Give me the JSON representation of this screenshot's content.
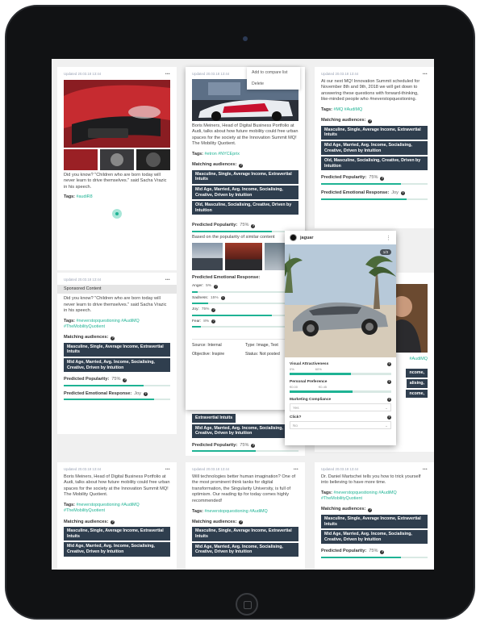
{
  "cards": {
    "c1": {
      "updated": "Updated 20.03.18 13:44",
      "more": "•••",
      "text": "Did you know? \"Children who are born today will never learn to drive themselves.\" said Sacha Vrazic in his speech.",
      "tags_label": "Tags:",
      "tags": "#audiR8"
    },
    "c2": {
      "updated": "Updated 20.03.18 13:44",
      "menu_add": "Add to compare list",
      "menu_delete": "Delete",
      "text": "Boris Meiners, Head of Digital Business Portfolio at Audi, talks about how future mobility could free urban spaces for the society at the Innovation Summit MQ! The Mobility Quotient.",
      "tags_label": "Tags:",
      "tags": "#etron #NYCEprix",
      "matching": "Matching audiences:",
      "aud1": "Masculine, Single, Average Income, Extravertial Intuits",
      "aud2": "Mid Age, Married, Avg. Income, Socialising, Creative, Driven by Intuition",
      "aud3": "Old, Masculine, Socialising, Creative, Driven by Intuition",
      "pop_label": "Predicted Popularity:",
      "pop_val": "75%",
      "similar": "Based on the popularity of similar content",
      "emo_label": "Predicted Emotional Response:",
      "anger_label": "Anger:",
      "anger_val": "5%",
      "sadness_label": "Sadness:",
      "sadness_val": "15%",
      "joy_label": "Joy:",
      "joy_val": "75%",
      "fear_label": "Fear:",
      "fear_val": "8%",
      "source_k": "Source:",
      "source_v": "Internal",
      "type_k": "Type:",
      "type_v": "Image, Text",
      "objective_k": "Objective:",
      "objective_v": "Inspire",
      "status_k": "Status:",
      "status_v": "Not posted"
    },
    "c3": {
      "updated": "Updated 20.03.18 13:44",
      "more": "•••",
      "text": "At our next MQ! Innovation Summit scheduled for November 8th and 9th, 2018 we will get down to answering these questions with forward-thinking, like-minded people who #neverstopquestioning.",
      "tags_label": "Tags:",
      "tags": "#MQ #AudiMQ",
      "matching": "Matching audiences:",
      "aud1": "Masculine, Single, Average Income, Extravertial Intuits",
      "aud2": "Mid Age, Married, Avg. Income, Socialising, Creative, Driven by Intuition",
      "aud3": "Old, Masculine, Socialising, Creative, Driven by Intuition",
      "pop_label": "Predicted Popularity:",
      "pop_val": "75%",
      "emo_label": "Predicted Emotional Response:",
      "emo_val": "Joy"
    },
    "c4": {
      "updated": "Updated 20.03.18 13:44",
      "more": "•••",
      "sponsored": "Sponsored Content",
      "text": "Did you know? \"Children who are born today will never learn to drive themselves.\" said Sacha Vrazic in his speech.",
      "tags_label": "Tags:",
      "tags": "#neverstopquestioning #AudiMQ #TheMobilityQuotient",
      "matching": "Matching audiences:",
      "aud1": "Masculine, Single, Average Income, Extravertial Intuits",
      "aud2": "Mid Age, Married, Avg. Income, Socialising, Creative, Driven by Intuition",
      "pop_label": "Predicted Popularity:",
      "pop_val": "75%",
      "emo_label": "Predicted Emotional Response:",
      "emo_val": "Joy"
    },
    "c5": {
      "aud1": "Extravertial Intuits",
      "aud2": "Mid Age, Married, Avg. Income, Socialising, Creative, Driven by Intuition",
      "pop_label": "Predicted Popularity:",
      "pop_val": "75%"
    },
    "c6": {
      "tags": "#AudiMQ",
      "aud_frag1": "ncome,",
      "aud_frag2": "alising,",
      "aud_frag3": "ncome,"
    },
    "c7": {
      "updated": "Updated 20.03.18 13:44",
      "more": "•••",
      "text": "Boris Meiners, Head of Digital Business Portfolio at Audi, talks about how future mobility could free urban spaces for the society at the Innovation Summit MQ! The Mobility Quotient.",
      "tags_label": "Tags:",
      "tags": "#neverstopquestioning #AudiMQ #TheMobilityQuotient",
      "matching": "Matching audiences:",
      "aud1": "Masculine, Single, Average Income, Extravertial Intuits",
      "aud2": "Mid Age, Married, Avg. Income, Socialising, Creative, Driven by Intuition"
    },
    "c8": {
      "updated": "Updated 20.03.18 13:44",
      "more": "•••",
      "text": "Will technologies better human imagination? One of the most prominent think tanks for digital transformation, the Singularity University, is full of optimism. Our reading tip for today comes highly recommended!",
      "tags_label": "Tags:",
      "tags": "#neverstopquestioning #AudiMQ",
      "matching": "Matching audiences:",
      "aud1": "Masculine, Single, Average Income, Extravertial Intuits",
      "aud2": "Mid Age, Married, Avg. Income, Socialising, Creative, Driven by Intuition"
    },
    "c9": {
      "updated": "Updated 20.03.18 13:44",
      "more": "•••",
      "text": "Dr. Daniel Martschei tells you how to trick yourself into believing to have more time.",
      "tags_label": "Tags:",
      "tags": "#neverstopquestioning #AudiMQ #TheMobilityQuotient",
      "matching": "Matching audiences:",
      "aud1": "Masculine, Single, Average Income, Extravertial Intuits",
      "aud2": "Mid Age, Married, Avg. Income, Socialising, Creative, Driven by Intuition",
      "pop_label": "Predicted Popularity:",
      "pop_val": "75%"
    }
  },
  "overlay": {
    "account": "jaguar",
    "more": "⋮",
    "counter": "1/3",
    "visual_label": "Visual Attractiveness",
    "visual_min": "0%",
    "visual_val": "60%",
    "personal_label": "Personal Preference",
    "personal_min": "€0.00",
    "personal_val": "€0.45",
    "marketing_label": "Marketing Compliance",
    "marketing_value": "Yes",
    "click_label": "Click?",
    "click_value": "No"
  },
  "levels": {
    "c2_pop": 0.75,
    "c2_anger": 0.05,
    "c2_sadness": 0.15,
    "c2_joy": 0.75,
    "c2_fear": 0.08,
    "c3_pop": 0.75,
    "c3_emo": 0.8,
    "c4_pop": 0.75,
    "c4_emo": 0.85,
    "c5_pop": 0.6,
    "c9_pop": 0.75,
    "visual": 0.6,
    "personal": 0.62
  },
  "colors": {
    "accent": "#1fb394",
    "audience_bg": "#2f3e4e",
    "tablet": "#111214"
  },
  "icons": {
    "more": "more-dots-icon",
    "help": "help-circle-icon",
    "dropdown": "chevron-down-icon",
    "home": "home-button-icon"
  }
}
